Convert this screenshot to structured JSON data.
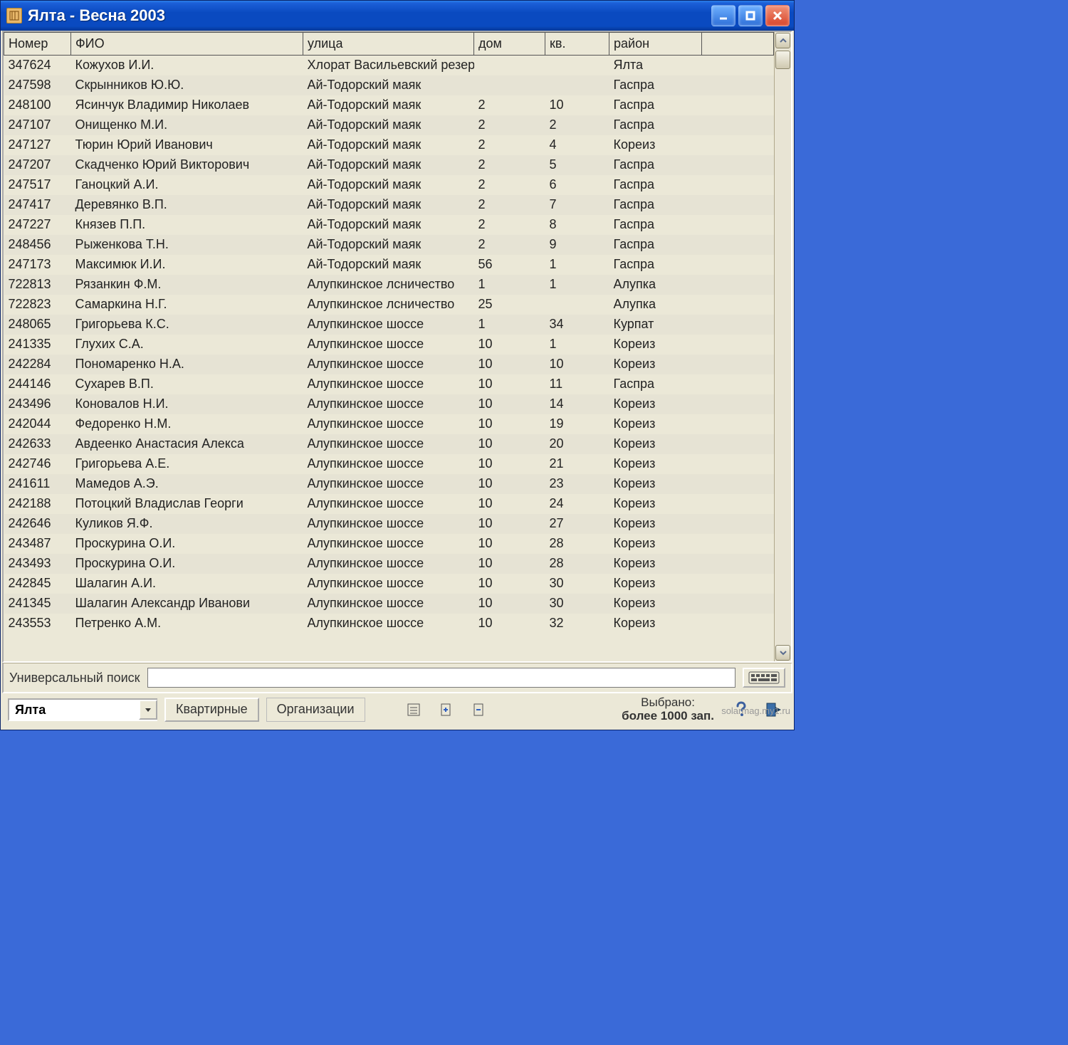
{
  "window": {
    "title": "Ялта  - Весна 2003"
  },
  "columns": {
    "number": "Номер",
    "fio": "ФИО",
    "street": "улица",
    "house": "дом",
    "flat": "кв.",
    "rayon": "район"
  },
  "rows": [
    {
      "num": "347624",
      "fio": "Кожухов И.И.",
      "street": " Хлорат Васильевский резер",
      "house": "",
      "flat": "",
      "rayon": "Ялта"
    },
    {
      "num": "247598",
      "fio": "Скрынников Ю.Ю.",
      "street": "Ай-Тодорский маяк",
      "house": "",
      "flat": "",
      "rayon": "Гаспра"
    },
    {
      "num": "248100",
      "fio": "Ясинчук Владимир Николаев",
      "street": "Ай-Тодорский маяк",
      "house": "2",
      "flat": "10",
      "rayon": "Гаспра"
    },
    {
      "num": "247107",
      "fio": "Онищенко М.И.",
      "street": "Ай-Тодорский маяк",
      "house": "2",
      "flat": "2",
      "rayon": "Гаспра"
    },
    {
      "num": "247127",
      "fio": "Тюрин Юрий Иванович",
      "street": "Ай-Тодорский маяк",
      "house": "2",
      "flat": "4",
      "rayon": "Кореиз"
    },
    {
      "num": "247207",
      "fio": "Скадченко Юрий Викторович",
      "street": "Ай-Тодорский маяк",
      "house": "2",
      "flat": "5",
      "rayon": "Гаспра"
    },
    {
      "num": "247517",
      "fio": "Ганоцкий А.И.",
      "street": "Ай-Тодорский маяк",
      "house": "2",
      "flat": "6",
      "rayon": "Гаспра"
    },
    {
      "num": "247417",
      "fio": "Деревянко В.П.",
      "street": "Ай-Тодорский маяк",
      "house": "2",
      "flat": "7",
      "rayon": "Гаспра"
    },
    {
      "num": "247227",
      "fio": "Князев П.П.",
      "street": "Ай-Тодорский маяк",
      "house": "2",
      "flat": "8",
      "rayon": "Гаспра"
    },
    {
      "num": "248456",
      "fio": "Рыженкова Т.Н.",
      "street": "Ай-Тодорский маяк",
      "house": "2",
      "flat": "9",
      "rayon": "Гаспра"
    },
    {
      "num": "247173",
      "fio": "Максимюк И.И.",
      "street": "Ай-Тодорский маяк",
      "house": "56",
      "flat": "1",
      "rayon": "Гаспра"
    },
    {
      "num": "722813",
      "fio": "Рязанкин Ф.М.",
      "street": "Алупкинское лсничество",
      "house": "1",
      "flat": "1",
      "rayon": "Алупка"
    },
    {
      "num": "722823",
      "fio": "Самаркина Н.Г.",
      "street": "Алупкинское лсничество",
      "house": "25",
      "flat": "",
      "rayon": "Алупка"
    },
    {
      "num": "248065",
      "fio": "Григорьева К.С.",
      "street": "Алупкинское шоссе",
      "house": "1",
      "flat": "34",
      "rayon": "Курпат"
    },
    {
      "num": "241335",
      "fio": "Глухих С.А.",
      "street": "Алупкинское шоссе",
      "house": "10",
      "flat": "1",
      "rayon": "Кореиз"
    },
    {
      "num": "242284",
      "fio": "Пономаренко Н.А.",
      "street": "Алупкинское шоссе",
      "house": "10",
      "flat": "10",
      "rayon": "Кореиз"
    },
    {
      "num": "244146",
      "fio": "Сухарев В.П.",
      "street": "Алупкинское шоссе",
      "house": "10",
      "flat": "11",
      "rayon": "Гаспра"
    },
    {
      "num": "243496",
      "fio": "Коновалов Н.И.",
      "street": "Алупкинское шоссе",
      "house": "10",
      "flat": "14",
      "rayon": "Кореиз"
    },
    {
      "num": "242044",
      "fio": "Федоренко Н.М.",
      "street": "Алупкинское шоссе",
      "house": "10",
      "flat": "19",
      "rayon": "Кореиз"
    },
    {
      "num": "242633",
      "fio": "Авдеенко Анастасия Алекса",
      "street": "Алупкинское шоссе",
      "house": "10",
      "flat": "20",
      "rayon": "Кореиз"
    },
    {
      "num": "242746",
      "fio": "Григорьева А.Е.",
      "street": "Алупкинское шоссе",
      "house": "10",
      "flat": "21",
      "rayon": "Кореиз"
    },
    {
      "num": "241611",
      "fio": "Мамедов А.Э.",
      "street": "Алупкинское шоссе",
      "house": "10",
      "flat": "23",
      "rayon": "Кореиз"
    },
    {
      "num": "242188",
      "fio": "Потоцкий Владислав Георги",
      "street": "Алупкинское шоссе",
      "house": "10",
      "flat": "24",
      "rayon": "Кореиз"
    },
    {
      "num": "242646",
      "fio": "Куликов Я.Ф.",
      "street": "Алупкинское шоссе",
      "house": "10",
      "flat": "27",
      "rayon": "Кореиз"
    },
    {
      "num": "243487",
      "fio": "Проскурина О.И.",
      "street": "Алупкинское шоссе",
      "house": "10",
      "flat": "28",
      "rayon": "Кореиз"
    },
    {
      "num": "243493",
      "fio": "Проскурина О.И.",
      "street": "Алупкинское шоссе",
      "house": "10",
      "flat": "28",
      "rayon": "Кореиз"
    },
    {
      "num": "242845",
      "fio": "Шалагин А.И.",
      "street": "Алупкинское шоссе",
      "house": "10",
      "flat": "30",
      "rayon": "Кореиз"
    },
    {
      "num": "241345",
      "fio": "Шалагин Александр Иванови",
      "street": "Алупкинское шоссе",
      "house": "10",
      "flat": "30",
      "rayon": "Кореиз"
    },
    {
      "num": "243553",
      "fio": "Петренко А.М.",
      "street": "Алупкинское шоссе",
      "house": "10",
      "flat": "32",
      "rayon": "Кореиз"
    }
  ],
  "search": {
    "label": "Универсальный поиск",
    "value": ""
  },
  "toolbar": {
    "city_selected": "Ялта",
    "btn_apartments": "Квартирные",
    "btn_orgs": "Организации",
    "selected_label": "Выбрано:",
    "selected_value": "более 1000 зап."
  },
  "watermark": "solarmag.my1.ru"
}
